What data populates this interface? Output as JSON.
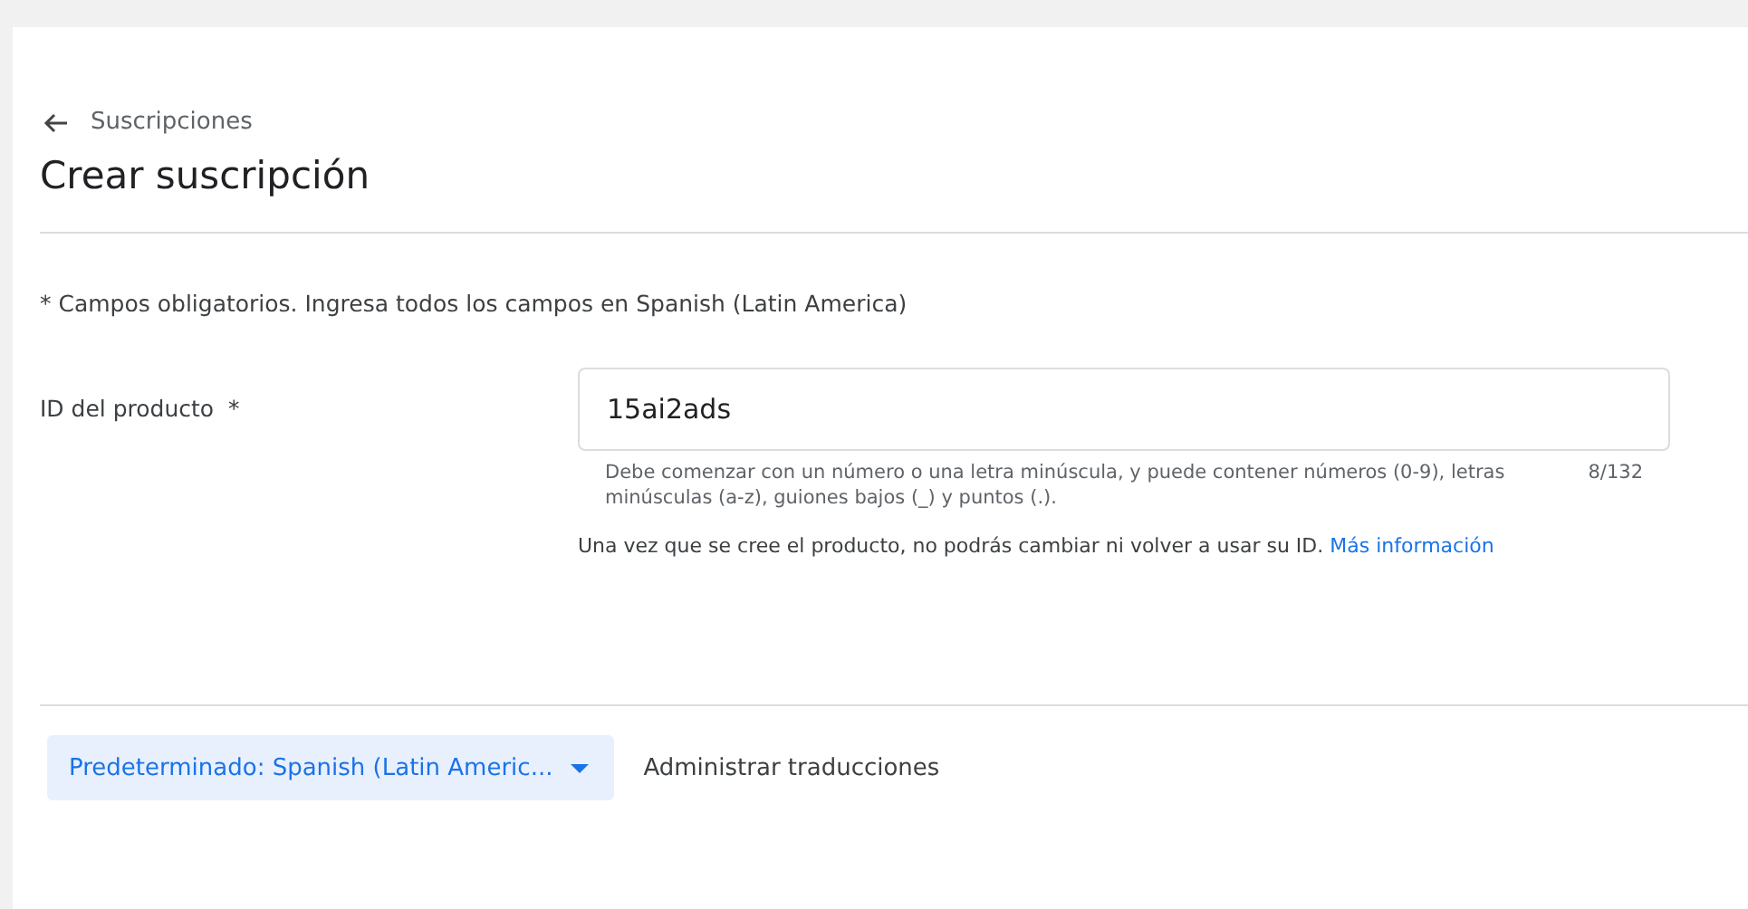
{
  "breadcrumb": {
    "label": "Suscripciones"
  },
  "title": "Crear suscripción",
  "required_note": "* Campos obligatorios. Ingresa todos los campos en Spanish (Latin America)",
  "product_id": {
    "label": "ID del producto  *",
    "value": "15ai2ads",
    "hint": "Debe comenzar con un número o una letra minúscula, y puede contener números (0-9), letras minúsculas (a-z), guiones bajos (_) y puntos (.).",
    "counter": "8/132",
    "notice": "Una vez que se cree el producto, no podrás cambiar ni volver a usar su ID.",
    "link": "Más información"
  },
  "footer": {
    "language_button": "Predeterminado: Spanish (Latin Americ...",
    "translations_button": "Administrar traducciones"
  }
}
